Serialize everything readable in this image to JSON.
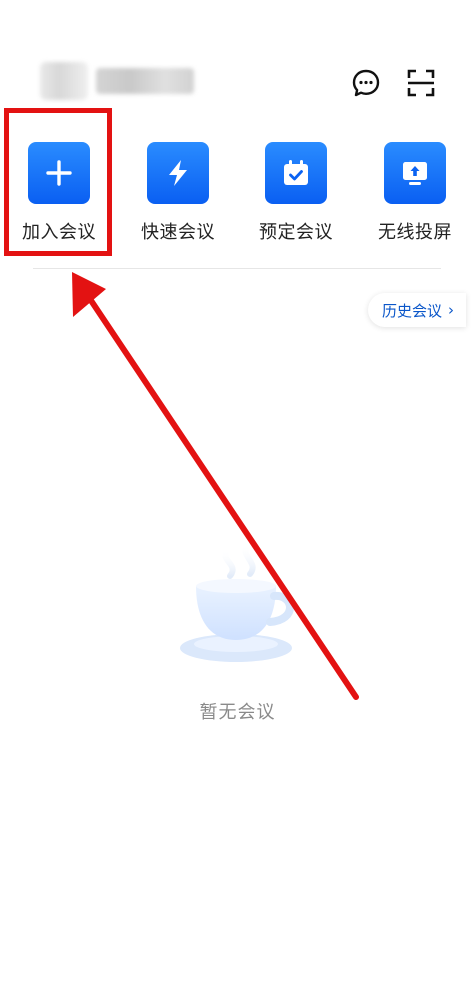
{
  "header": {
    "icons": [
      "chat-bubble-icon",
      "scan-icon"
    ]
  },
  "actions": [
    {
      "label": "加入会议",
      "icon": "plus-icon"
    },
    {
      "label": "快速会议",
      "icon": "lightning-icon"
    },
    {
      "label": "预定会议",
      "icon": "calendar-check-icon"
    },
    {
      "label": "无线投屏",
      "icon": "screen-cast-icon"
    }
  ],
  "history_button": {
    "label": "历史会议"
  },
  "empty_state": {
    "text": "暂无会议",
    "icon": "empty-cup-icon"
  },
  "colors": {
    "accent": "#0a62f2",
    "highlight": "#e31212"
  }
}
